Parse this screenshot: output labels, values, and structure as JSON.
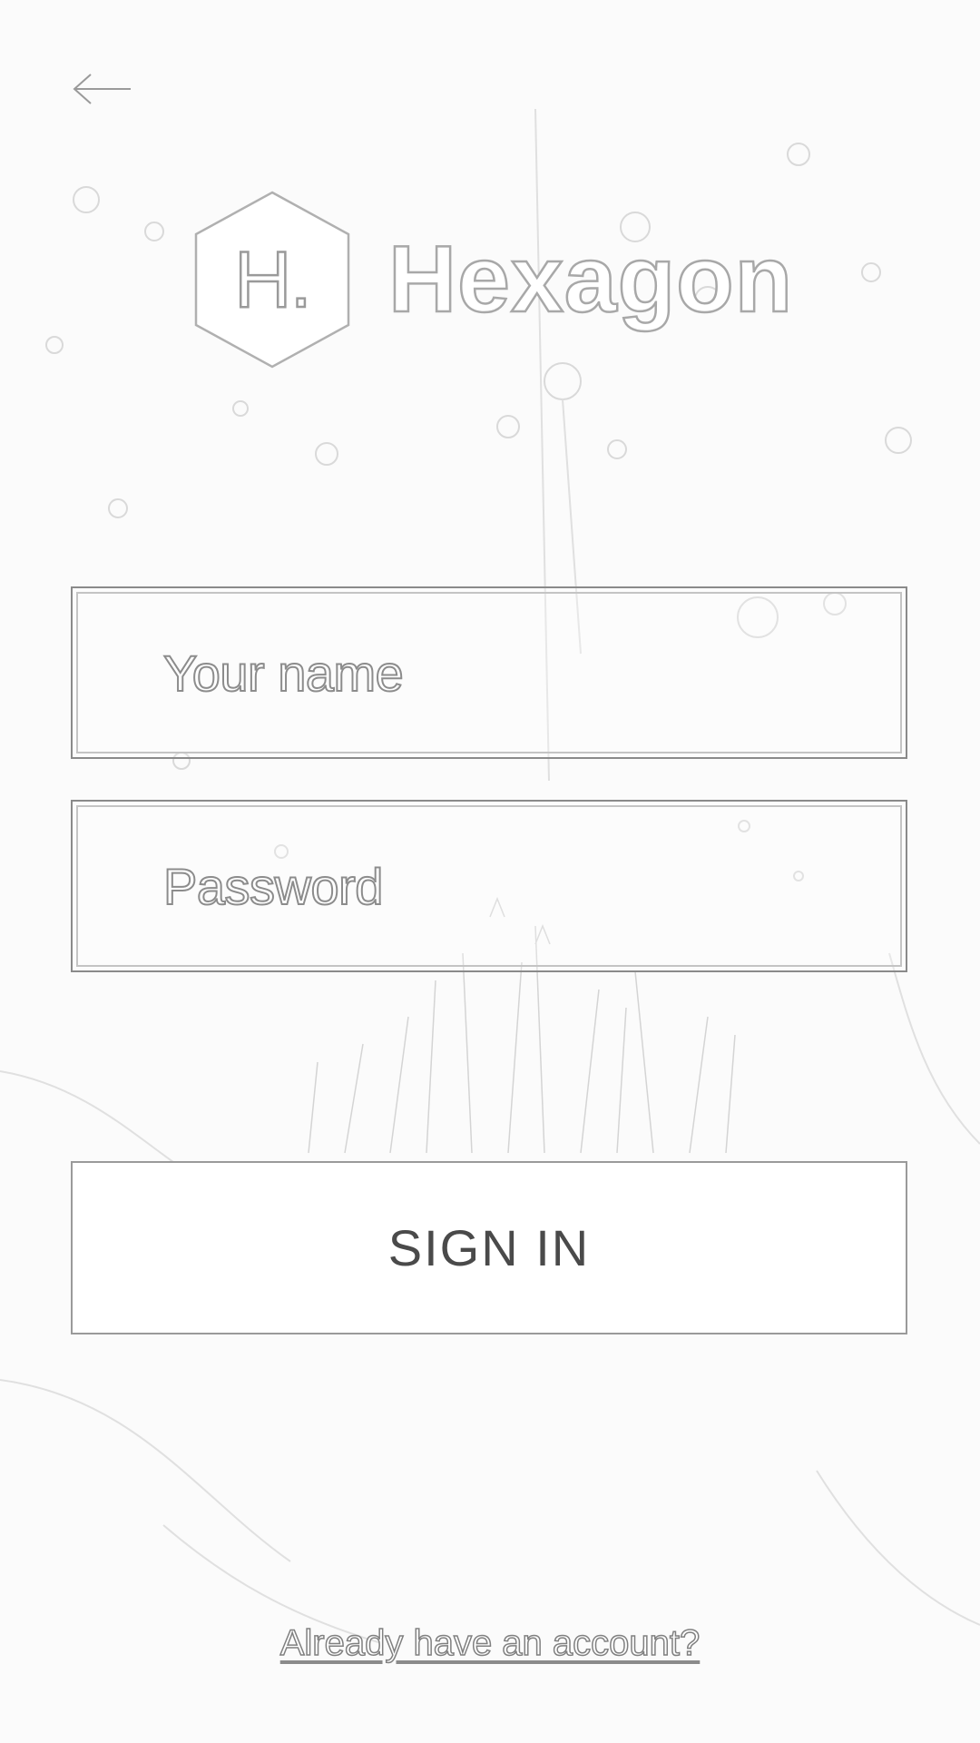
{
  "header": {
    "back_icon": "arrow-left-icon"
  },
  "brand": {
    "mark": "H.",
    "name": "Hexagon",
    "logo_icon": "hexagon-icon"
  },
  "form": {
    "name_placeholder": "Your name",
    "password_placeholder": "Password",
    "signin_label": "SIGN IN"
  },
  "footer": {
    "account_link": "Already have an account?"
  },
  "colors": {
    "background": "#fbfbfb",
    "outline": "#8a8a8a",
    "button_bg": "#ffffff",
    "button_text": "#4a4a4a"
  }
}
